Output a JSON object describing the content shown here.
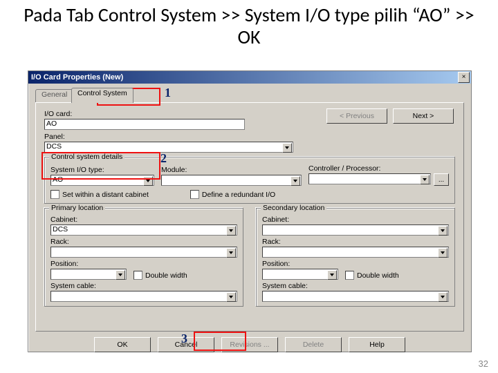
{
  "heading": "Pada Tab Control System >> System I/O type pilih “AO” >> OK",
  "window": {
    "title": "I/O Card Properties (New)",
    "close": "×",
    "tabs": {
      "general": "General",
      "control_system": "Control System"
    },
    "nav": {
      "prev": "< Previous",
      "next": "Next >"
    },
    "labels": {
      "io_card": "I/O card:",
      "panel": "Panel:",
      "control_system_details": "Control system details",
      "system_io_type": "System I/O type:",
      "module": "Module:",
      "controller": "Controller / Processor:",
      "set_within": "Set within a distant cabinet",
      "define_redundant": "Define a redundant I/O",
      "primary_location": "Primary location",
      "secondary_location": "Secondary location",
      "cabinet": "Cabinet:",
      "rack": "Rack:",
      "position": "Position:",
      "double_width": "Double width",
      "system_cable": "System cable:"
    },
    "values": {
      "io_card": "AO",
      "panel": "DCS",
      "system_io_type": "AO",
      "module": "",
      "controller": "",
      "cabinet_primary": "DCS",
      "cabinet_secondary": "",
      "rack_primary": "",
      "rack_secondary": "",
      "position_primary": "",
      "position_secondary": "",
      "system_cable_primary": "",
      "system_cable_secondary": "",
      "ellipsis": "..."
    },
    "buttons": {
      "ok": "OK",
      "cancel": "Cancel",
      "revisions": "Revisions ...",
      "delete": "Delete",
      "help": "Help"
    }
  },
  "callouts": {
    "n1": "1",
    "n2": "2",
    "n3": "3"
  },
  "page_number": "32"
}
